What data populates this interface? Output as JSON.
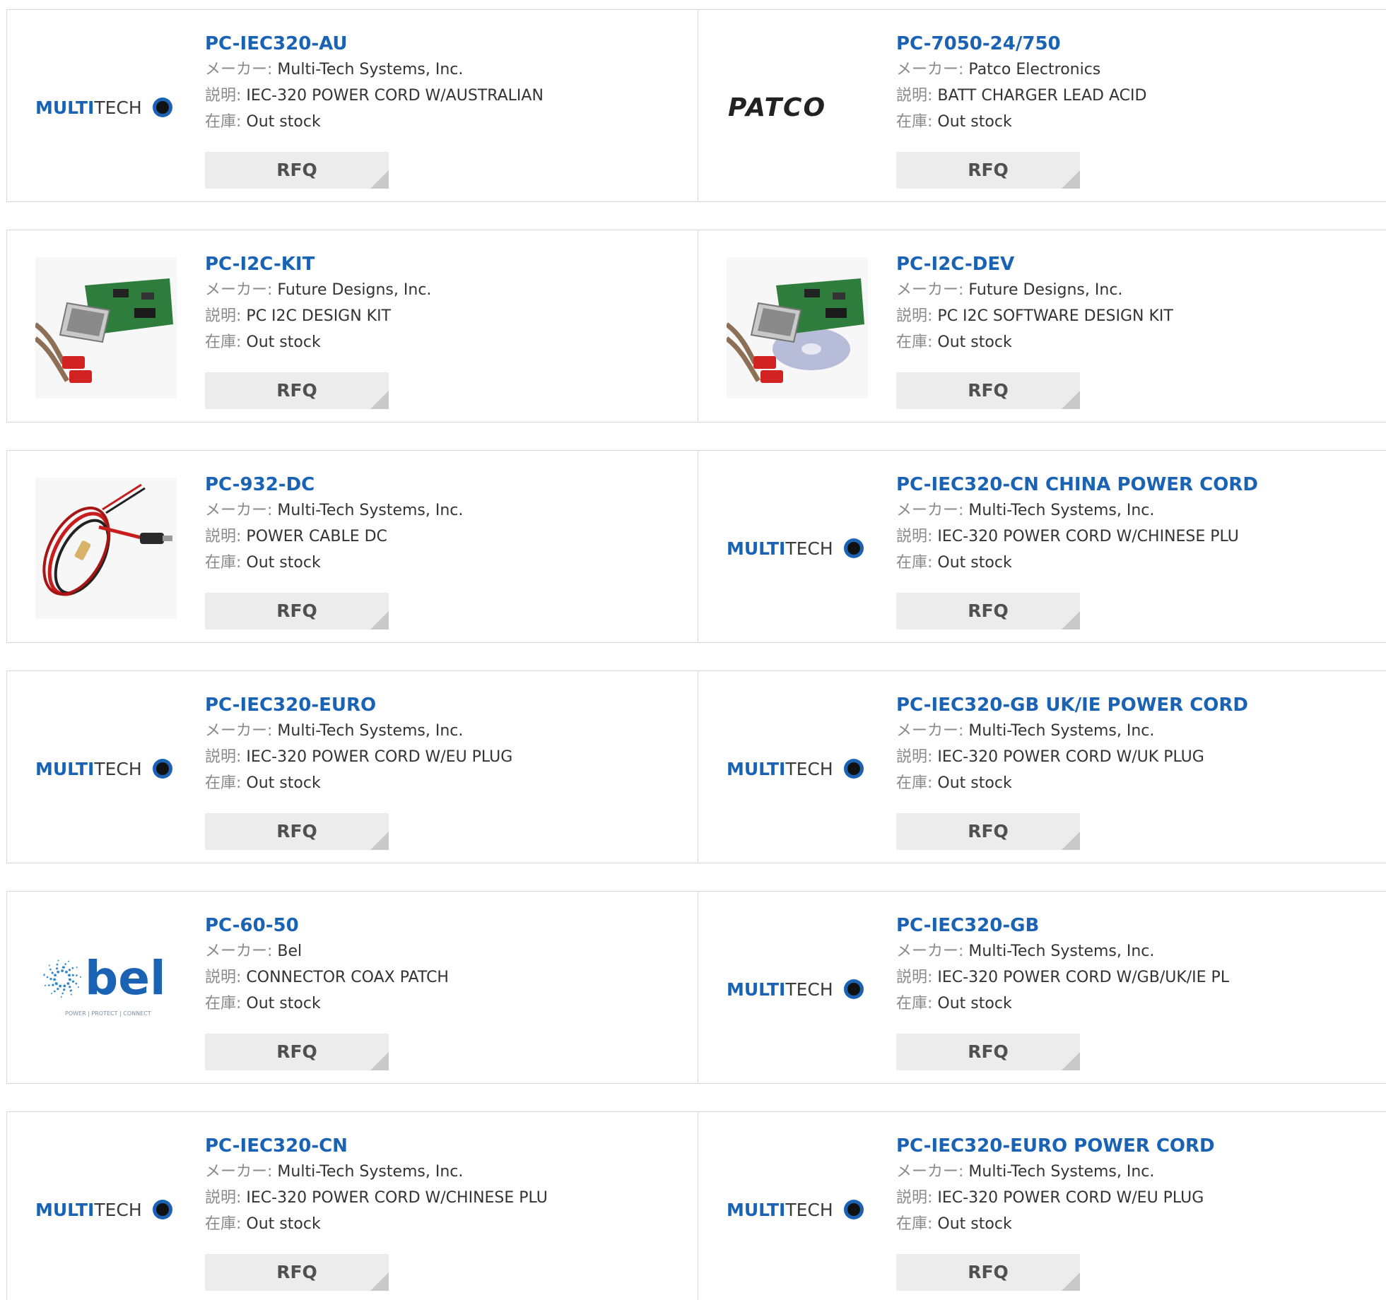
{
  "labels": {
    "maker": "メーカー:",
    "desc": "説明:",
    "stock": "在庫:"
  },
  "rfq_label": "RFQ",
  "colors": {
    "link": "#1a63b4",
    "border": "#d7d7d7",
    "button": "#ececec"
  },
  "logos": {
    "multitech": {
      "a": "MULTI",
      "b": "TECH"
    },
    "patco": "PATCO",
    "bel": {
      "word": "bel",
      "tag": "POWER | PROTECT | CONNECT"
    }
  },
  "products": [
    {
      "pn": "PC-IEC320-AU",
      "maker": "Multi-Tech Systems, Inc.",
      "desc": "IEC-320 POWER CORD W/AUSTRALIAN",
      "stock": "Out stock",
      "image": "multitech-logo"
    },
    {
      "pn": "PC-7050-24/750",
      "maker": "Patco Electronics",
      "desc": "BATT CHARGER LEAD ACID",
      "stock": "Out stock",
      "image": "patco-logo"
    },
    {
      "pn": "PC-I2C-KIT",
      "maker": "Future Designs, Inc.",
      "desc": "PC I2C DESIGN KIT",
      "stock": "Out stock",
      "image": "i2c-board-photo"
    },
    {
      "pn": "PC-I2C-DEV",
      "maker": "Future Designs, Inc.",
      "desc": "PC I2C SOFTWARE DESIGN KIT",
      "stock": "Out stock",
      "image": "i2c-board-cd-photo"
    },
    {
      "pn": "PC-932-DC",
      "maker": "Multi-Tech Systems, Inc.",
      "desc": "POWER CABLE DC",
      "stock": "Out stock",
      "image": "dc-cable-photo"
    },
    {
      "pn": "PC-IEC320-CN CHINA POWER CORD",
      "maker": "Multi-Tech Systems, Inc.",
      "desc": "IEC-320 POWER CORD W/CHINESE PLU",
      "stock": "Out stock",
      "image": "multitech-logo"
    },
    {
      "pn": "PC-IEC320-EURO",
      "maker": "Multi-Tech Systems, Inc.",
      "desc": "IEC-320 POWER CORD W/EU PLUG",
      "stock": "Out stock",
      "image": "multitech-logo"
    },
    {
      "pn": "PC-IEC320-GB UK/IE POWER CORD",
      "maker": "Multi-Tech Systems, Inc.",
      "desc": "IEC-320 POWER CORD W/UK PLUG",
      "stock": "Out stock",
      "image": "multitech-logo"
    },
    {
      "pn": "PC-60-50",
      "maker": "Bel",
      "desc": "CONNECTOR COAX PATCH",
      "stock": "Out stock",
      "image": "bel-logo"
    },
    {
      "pn": "PC-IEC320-GB",
      "maker": "Multi-Tech Systems, Inc.",
      "desc": "IEC-320 POWER CORD W/GB/UK/IE PL",
      "stock": "Out stock",
      "image": "multitech-logo"
    },
    {
      "pn": "PC-IEC320-CN",
      "maker": "Multi-Tech Systems, Inc.",
      "desc": "IEC-320 POWER CORD W/CHINESE PLU",
      "stock": "Out stock",
      "image": "multitech-logo"
    },
    {
      "pn": "PC-IEC320-EURO POWER CORD",
      "maker": "Multi-Tech Systems, Inc.",
      "desc": "IEC-320 POWER CORD W/EU PLUG",
      "stock": "Out stock",
      "image": "multitech-logo"
    }
  ]
}
